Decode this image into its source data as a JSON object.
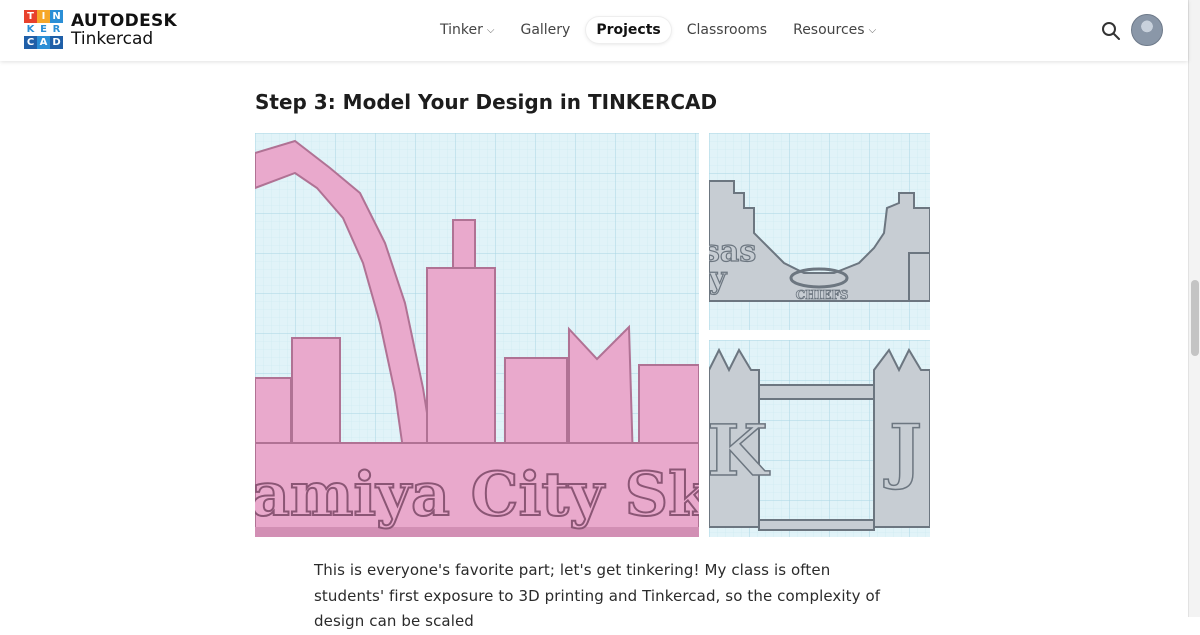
{
  "header": {
    "logo": {
      "letters": [
        "T",
        "I",
        "N",
        "K",
        "E",
        "R",
        "C",
        "A",
        "D"
      ],
      "brand": "AUTODESK",
      "product": "Tinkercad"
    },
    "nav": [
      {
        "label": "Tinker",
        "dropdown": true,
        "active": false
      },
      {
        "label": "Gallery",
        "dropdown": false,
        "active": false
      },
      {
        "label": "Projects",
        "dropdown": false,
        "active": true
      },
      {
        "label": "Classrooms",
        "dropdown": false,
        "active": false
      },
      {
        "label": "Resources",
        "dropdown": true,
        "active": false
      }
    ],
    "search_icon": "search-icon",
    "avatar_icon": "user-avatar"
  },
  "article": {
    "step_title": "Step 3: Model Your Design in TINKERCAD",
    "images": {
      "main_text": "amiya City Skylin",
      "top_text_1": "sas",
      "top_text_2": "y",
      "top_logo_text": "CHIEFS",
      "bottom_letter_left": "K",
      "bottom_letter_right": "J"
    },
    "paragraph": "This is everyone's favorite part; let's get tinkering! My class is often students' first exposure to 3D printing and Tinkercad, so the complexity of design can be scaled"
  },
  "colors": {
    "grid_bg": "#dff2f7",
    "grid_line": "#b7dde8",
    "pink": "#e9a9cc",
    "pink_dark": "#b07294",
    "gray": "#c7cdd3",
    "gray_dark": "#6c7680"
  }
}
